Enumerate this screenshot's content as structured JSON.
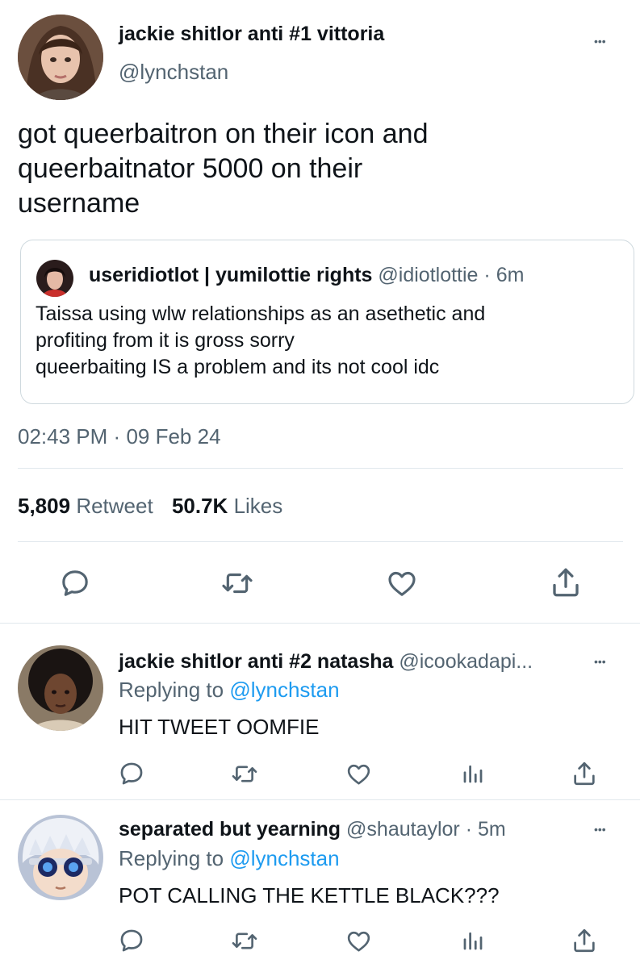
{
  "main_tweet": {
    "display_name": "jackie shitlor anti #1 vittoria",
    "handle": "@lynchstan",
    "text_line1": "got queerbaitron on their icon and",
    "text_line2": "queerbaitnator 5000 on their",
    "text_line3": "username",
    "time": "02:43 PM",
    "separator": "·",
    "date": "09 Feb 24",
    "retweet_count": "5,809",
    "retweet_label": "Retweet",
    "like_count": "50.7K",
    "like_label": "Likes"
  },
  "quoted_tweet": {
    "display_name": "useridiotlot | yumilottie rights",
    "handle": "@idiotlottie",
    "time": "· 6m",
    "text_line1": "Taissa using wlw relationships as an asethetic and",
    "text_line2": "profiting from it is gross sorry",
    "text_line3": "queerbaiting IS a problem and its not cool idc"
  },
  "replies": [
    {
      "display_name": "jackie shitlor anti #2 natasha",
      "handle": "@icookadapi...",
      "time": "",
      "replying_prefix": "Replying to",
      "replying_handle": "@lynchstan",
      "text": "HIT TWEET OOMFIE"
    },
    {
      "display_name": "separated but yearning",
      "handle": "@shautaylor",
      "time": "· 5m",
      "replying_prefix": "Replying to",
      "replying_handle": "@lynchstan",
      "text": "POT CALLING THE KETTLE BLACK???"
    }
  ],
  "more_glyph": "•••",
  "colors": {
    "accent": "#1d9bf0",
    "muted": "#536471",
    "divider": "#e1e8ed",
    "text": "#0f1419"
  },
  "icons": [
    "reply-icon",
    "retweet-icon",
    "like-icon",
    "share-icon",
    "analytics-icon",
    "more-icon"
  ]
}
